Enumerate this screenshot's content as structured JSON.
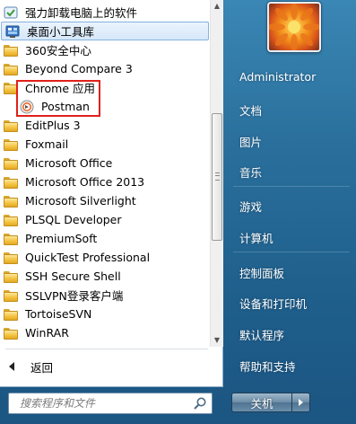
{
  "programs": {
    "items": [
      {
        "label": "强力卸载电脑上的软件",
        "icon": "uninstall-app-icon",
        "selected": false
      },
      {
        "label": "桌面小工具库",
        "icon": "gadgets-gallery-icon",
        "selected": true
      },
      {
        "label": "360安全中心",
        "icon": "folder-icon",
        "selected": false
      },
      {
        "label": "Beyond Compare 3",
        "icon": "folder-icon",
        "selected": false
      },
      {
        "label": "Chrome 应用",
        "icon": "folder-icon",
        "selected": false
      },
      {
        "label": "Postman",
        "icon": "postman-icon",
        "selected": false,
        "sub": true
      },
      {
        "label": "EditPlus 3",
        "icon": "folder-icon",
        "selected": false
      },
      {
        "label": "Foxmail",
        "icon": "folder-icon",
        "selected": false
      },
      {
        "label": "Microsoft Office",
        "icon": "folder-icon",
        "selected": false
      },
      {
        "label": "Microsoft Office 2013",
        "icon": "folder-icon",
        "selected": false
      },
      {
        "label": "Microsoft Silverlight",
        "icon": "folder-icon",
        "selected": false
      },
      {
        "label": "PLSQL Developer",
        "icon": "folder-icon",
        "selected": false
      },
      {
        "label": "PremiumSoft",
        "icon": "folder-icon",
        "selected": false
      },
      {
        "label": "QuickTest Professional",
        "icon": "folder-icon",
        "selected": false
      },
      {
        "label": "SSH Secure Shell",
        "icon": "folder-icon",
        "selected": false
      },
      {
        "label": "SSLVPN登录客户端",
        "icon": "folder-icon",
        "selected": false
      },
      {
        "label": "TortoiseSVN",
        "icon": "folder-icon",
        "selected": false
      },
      {
        "label": "WinRAR",
        "icon": "folder-icon",
        "selected": false
      }
    ],
    "back_label": "返回"
  },
  "search": {
    "placeholder": "搜索程序和文件"
  },
  "right": {
    "user_name": "Administrator",
    "links": [
      "文档",
      "图片",
      "音乐",
      "游戏",
      "计算机",
      "控制面板",
      "设备和打印机",
      "默认程序",
      "帮助和支持"
    ]
  },
  "shutdown": {
    "label": "关机"
  },
  "colors": {
    "highlight_border": "#e0201b",
    "selected_bg": "#d7e8f9",
    "menu_blue": "#2a6f9c"
  }
}
